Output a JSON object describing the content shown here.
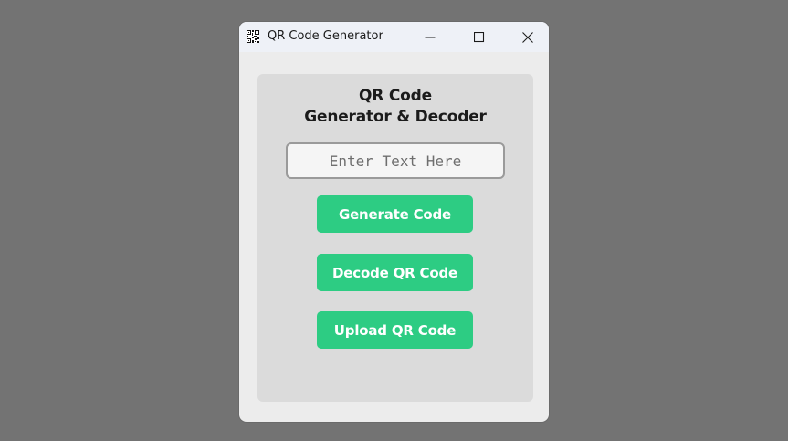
{
  "window": {
    "title": "QR Code Generator",
    "app_icon": "qr-code-icon",
    "controls": [
      "minimize-icon",
      "maximize-icon",
      "close-icon"
    ]
  },
  "panel": {
    "heading_line1": "QR Code",
    "heading_line2": "Generator & Decoder",
    "input": {
      "value": "",
      "placeholder": "Enter Text Here"
    },
    "buttons": {
      "generate": "Generate Code",
      "decode": "Decode QR Code",
      "upload": "Upload QR Code"
    }
  },
  "colors": {
    "desktop_background": "#737373",
    "window_background": "#ececec",
    "titlebar": "#eef1f7",
    "panel_background": "#dbdbdb",
    "accent_button": "#2dcc83",
    "button_text": "#ffffff"
  }
}
